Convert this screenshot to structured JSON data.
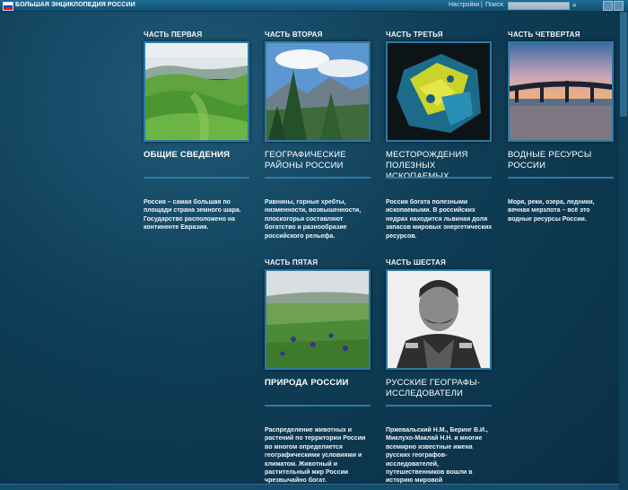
{
  "topbar": {
    "title": "БОЛЬШАЯ ЭНЦИКЛОПЕДИЯ РОССИИ",
    "settings_label": "Настройки",
    "separator": "|",
    "search_label": "Поиск:",
    "search_value": "",
    "go_icon": "double-arrow-right-icon",
    "flag_colors": [
      "#ffffff",
      "#1c3fb5",
      "#d5192b"
    ]
  },
  "cards": [
    {
      "heading": "ЧАСТЬ ПЕРВАЯ",
      "title": "ОБЩИЕ СВЕДЕНИЯ",
      "description": "Россия – самая большая по площади страна земного шара. Государство расположено на континенте Евразия.",
      "image": "green-hills-photo"
    },
    {
      "heading": "ЧАСТЬ ВТОРАЯ",
      "title": "ГЕОГРАФИЧЕСКИЕ РАЙОНЫ РОССИИ",
      "description": "Равнины, горные хребты, низменности, возвышенности, плоскогорья составляют богатство и разнообразие российского рельефа.",
      "image": "mountain-forest-photo"
    },
    {
      "heading": "ЧАСТЬ ТРЕТЬЯ",
      "title": "МЕСТОРОЖДЕНИЯ ПОЛЕЗНЫХ ИСКОПАЕМЫХ",
      "description": "Россия богата полезными ископаемыми. В российских недрах находится львиная доля запасов мировых энергетических ресурсов.",
      "image": "mineral-rock-photo"
    },
    {
      "heading": "ЧАСТЬ ЧЕТВЕРТАЯ",
      "title": "ВОДНЫЕ РЕСУРСЫ РОССИИ",
      "description": "Моря, реки, озера, ледники, вечная мерзлота – всё это водные ресурсы России.",
      "image": "bridge-river-sunset-photo"
    },
    {
      "heading": "ЧАСТЬ ПЯТАЯ",
      "title": "ПРИРОДА РОССИИ",
      "description": "Распределение животных и растений по территории России во многом определяется географическими условиями и климатом. Животный и растительный мир России чрезвычайно богат.",
      "image": "steppe-flowers-photo"
    },
    {
      "heading": "ЧАСТЬ ШЕСТАЯ",
      "title": "РУССКИЕ ГЕОГРАФЫ-ИССЛЕДОВАТЕЛИ",
      "description": "Пржевальский Н.М., Беринг В.И., Миклухо-Маклай Н.Н. и многие всемирно известные имена русских географов-исследователей, путешественников вошли в историю мировой",
      "image": "explorer-portrait-photo"
    }
  ]
}
